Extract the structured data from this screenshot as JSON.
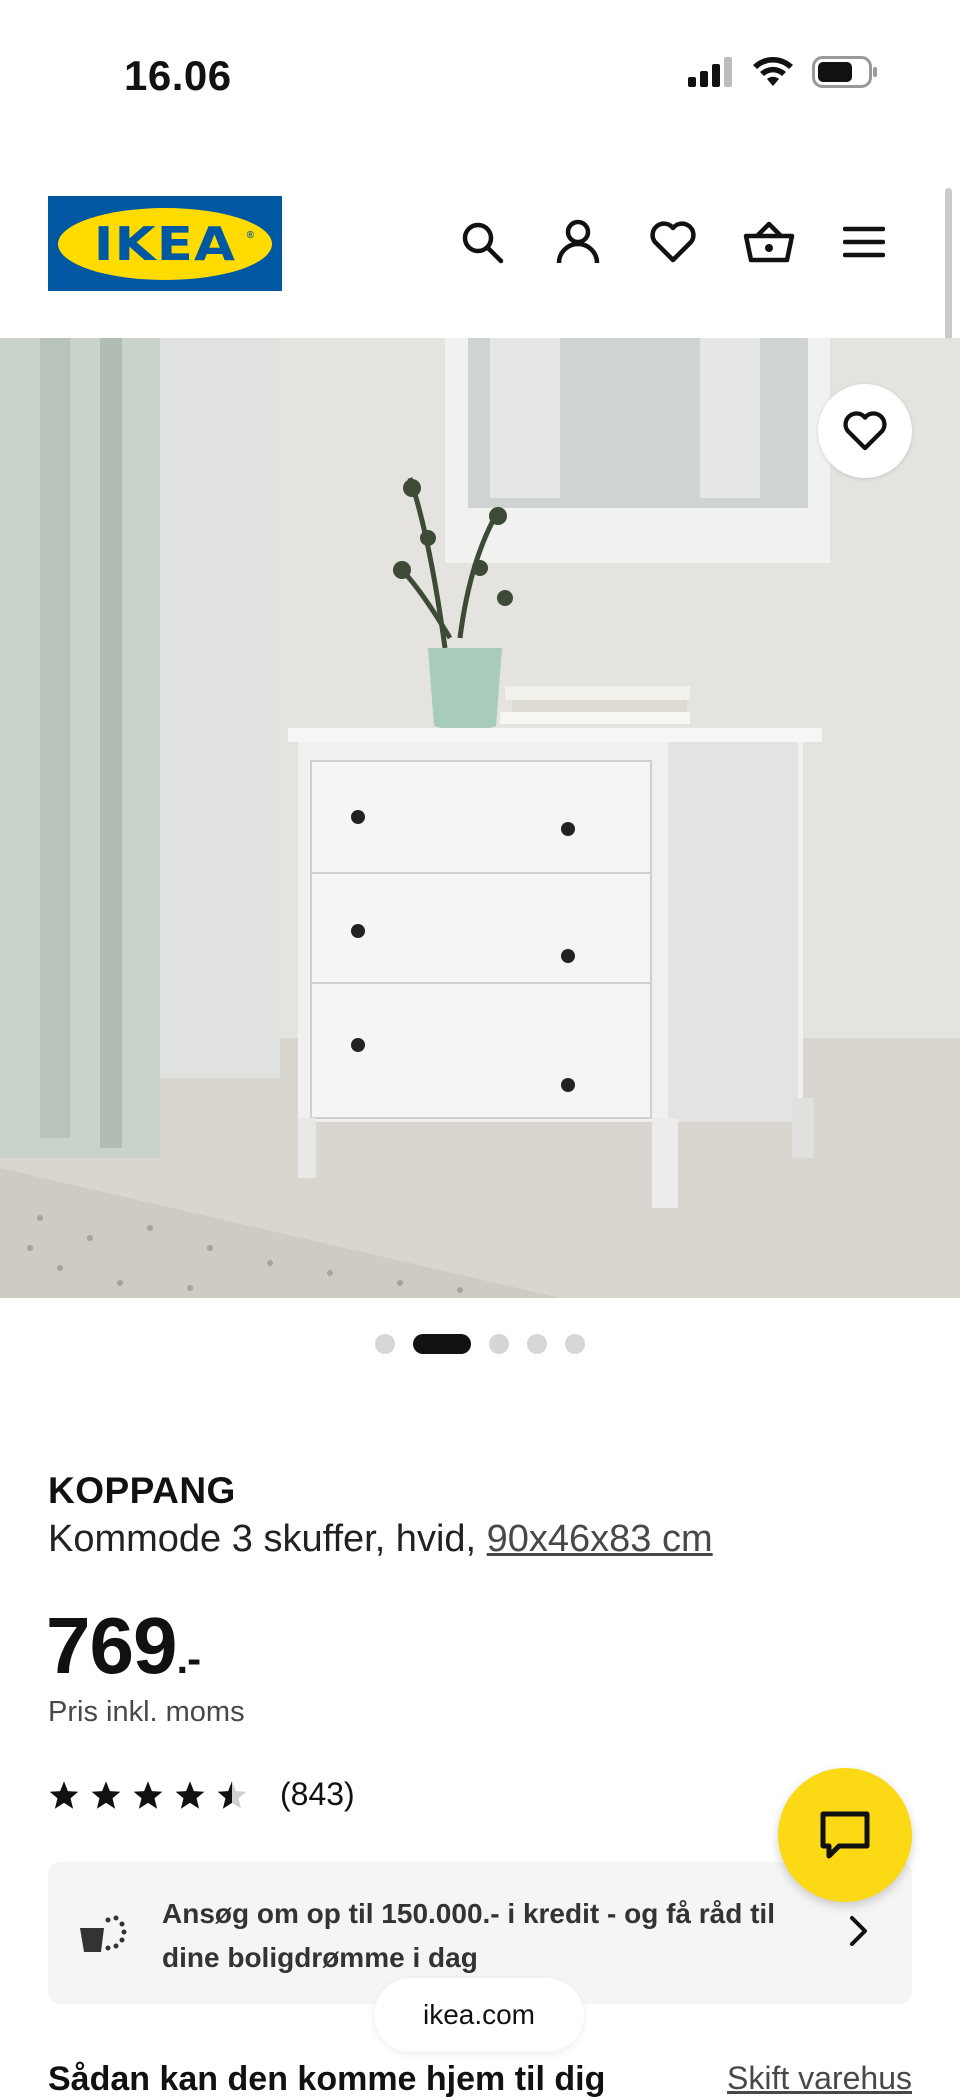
{
  "status_bar": {
    "time": "16.06"
  },
  "header": {
    "logo_text": "IKEA",
    "icons": [
      "search-icon",
      "account-icon",
      "heart-icon",
      "basket-icon",
      "menu-icon"
    ]
  },
  "gallery": {
    "dot_count": 5,
    "active_index": 1
  },
  "product": {
    "name": "KOPPANG",
    "description": "Kommode 3 skuffer, hvid, ",
    "dimensions": "90x46x83 cm",
    "price": "769",
    "price_suffix": ".-",
    "price_note": "Pris inkl. moms",
    "rating": 4.5,
    "rating_count": "(843)"
  },
  "credit_banner": {
    "text": "Ansøg om op til 150.000.- i kredit - og få råd til dine boligdrømme i dag"
  },
  "browser": {
    "url": "ikea.com"
  },
  "delivery": {
    "title": "Sådan kan den komme hjem til dig",
    "change_store": "Skift varehus"
  },
  "colors": {
    "ikea_blue": "#0058a3",
    "ikea_yellow": "#ffdb00",
    "chat_yellow": "#fbd914"
  }
}
